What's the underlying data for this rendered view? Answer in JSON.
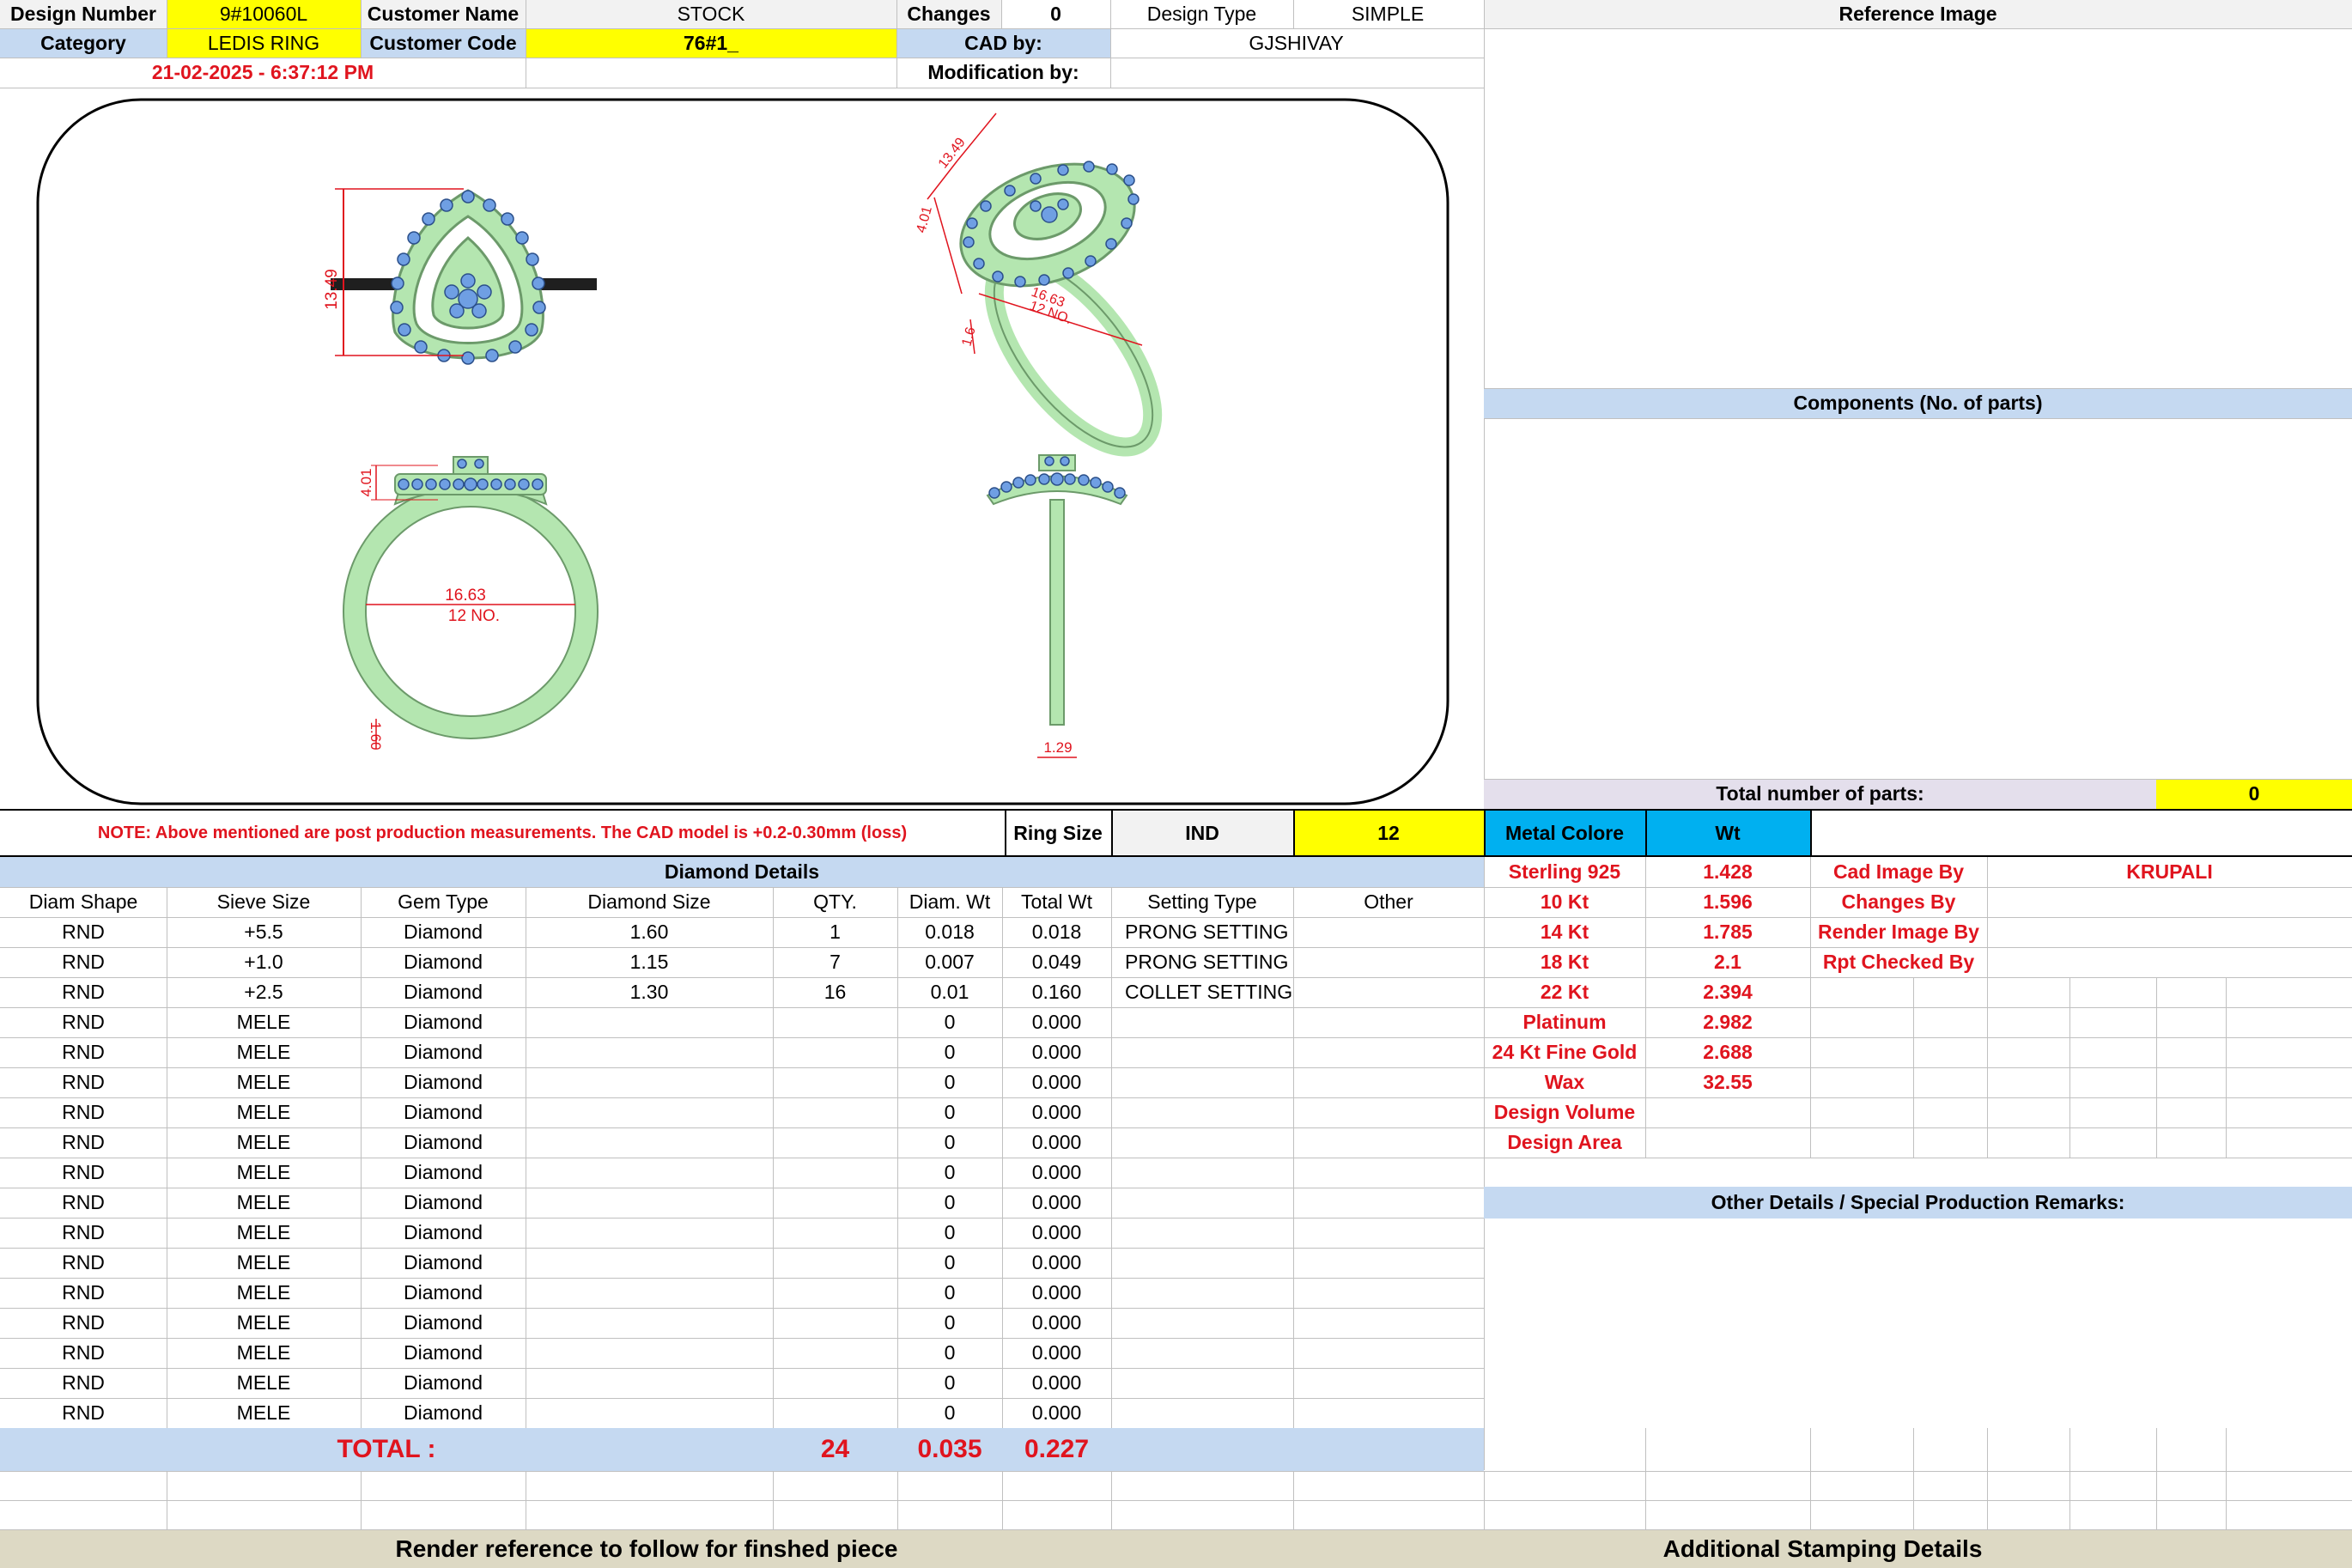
{
  "header": {
    "design_number_label": "Design Number",
    "design_number": "9#10060L",
    "customer_name_label": "Customer Name",
    "customer_name": "STOCK",
    "changes_label": "Changes",
    "changes": "0",
    "design_type_label": "Design Type",
    "design_type": "SIMPLE",
    "reference_image_label": "Reference Image",
    "category_label": "Category",
    "category": "LEDIS RING",
    "customer_code_label": "Customer Code",
    "customer_code": "76#1_",
    "cad_by_label": "CAD by:",
    "cad_by": "GJSHIVAY",
    "timestamp": "21-02-2025 - 6:37:12 PM",
    "modification_by_label": "Modification by:"
  },
  "drawing": {
    "dim_height": "13.49",
    "dim_head": "4.01",
    "dim_inner": "16.63",
    "dim_size": "12 NO.",
    "dim_shank": "1.60",
    "dim_width": "1.29",
    "persp_width": "13.49",
    "persp_head": "4.01",
    "persp_inner": "16.63",
    "persp_size": "12 NO.",
    "persp_shank": "1.6"
  },
  "components": {
    "label": "Components (No. of parts)",
    "total_label": "Total number of parts:",
    "total": "0"
  },
  "note": "NOTE: Above mentioned are post production measurements. The CAD model is +0.2-0.30mm (loss)",
  "ring": {
    "size_label": "Ring Size",
    "standard": "IND",
    "size": "12",
    "metal_label": "Metal Colore",
    "wt_label": "Wt"
  },
  "diamond": {
    "title": "Diamond Details",
    "columns": [
      "Diam Shape",
      "Sieve Size",
      "Gem Type",
      "Diamond Size",
      "QTY.",
      "Diam. Wt",
      "Total Wt",
      "Setting Type",
      "Other"
    ],
    "rows": [
      [
        "RND",
        "+5.5",
        "Diamond",
        "1.60",
        "1",
        "0.018",
        "0.018",
        "PRONG SETTING",
        ""
      ],
      [
        "RND",
        "+1.0",
        "Diamond",
        "1.15",
        "7",
        "0.007",
        "0.049",
        "PRONG SETTING",
        ""
      ],
      [
        "RND",
        "+2.5",
        "Diamond",
        "1.30",
        "16",
        "0.01",
        "0.160",
        "COLLET SETTING",
        ""
      ],
      [
        "RND",
        "MELE",
        "Diamond",
        "",
        "",
        "0",
        "0.000",
        "",
        ""
      ],
      [
        "RND",
        "MELE",
        "Diamond",
        "",
        "",
        "0",
        "0.000",
        "",
        ""
      ],
      [
        "RND",
        "MELE",
        "Diamond",
        "",
        "",
        "0",
        "0.000",
        "",
        ""
      ],
      [
        "RND",
        "MELE",
        "Diamond",
        "",
        "",
        "0",
        "0.000",
        "",
        ""
      ],
      [
        "RND",
        "MELE",
        "Diamond",
        "",
        "",
        "0",
        "0.000",
        "",
        ""
      ],
      [
        "RND",
        "MELE",
        "Diamond",
        "",
        "",
        "0",
        "0.000",
        "",
        ""
      ],
      [
        "RND",
        "MELE",
        "Diamond",
        "",
        "",
        "0",
        "0.000",
        "",
        ""
      ],
      [
        "RND",
        "MELE",
        "Diamond",
        "",
        "",
        "0",
        "0.000",
        "",
        ""
      ],
      [
        "RND",
        "MELE",
        "Diamond",
        "",
        "",
        "0",
        "0.000",
        "",
        ""
      ],
      [
        "RND",
        "MELE",
        "Diamond",
        "",
        "",
        "0",
        "0.000",
        "",
        ""
      ],
      [
        "RND",
        "MELE",
        "Diamond",
        "",
        "",
        "0",
        "0.000",
        "",
        ""
      ],
      [
        "RND",
        "MELE",
        "Diamond",
        "",
        "",
        "0",
        "0.000",
        "",
        ""
      ],
      [
        "RND",
        "MELE",
        "Diamond",
        "",
        "",
        "0",
        "0.000",
        "",
        ""
      ],
      [
        "RND",
        "MELE",
        "Diamond",
        "",
        "",
        "0",
        "0.000",
        "",
        ""
      ]
    ],
    "total_label": "TOTAL :",
    "total_qty": "24",
    "total_diam_wt": "0.035",
    "total_wt": "0.227"
  },
  "metals": [
    {
      "name": "Sterling 925",
      "wt": "1.428"
    },
    {
      "name": "10 Kt",
      "wt": "1.596"
    },
    {
      "name": "14 Kt",
      "wt": "1.785"
    },
    {
      "name": "18 Kt",
      "wt": "2.1"
    },
    {
      "name": "22 Kt",
      "wt": "2.394"
    },
    {
      "name": "Platinum",
      "wt": "2.982"
    },
    {
      "name": "24 Kt Fine Gold",
      "wt": "2.688"
    },
    {
      "name": "Wax",
      "wt": "32.55"
    },
    {
      "name": "Design Volume",
      "wt": ""
    },
    {
      "name": "Design Area",
      "wt": ""
    }
  ],
  "credits": [
    {
      "label": "Cad Image By",
      "value": "KRUPALI"
    },
    {
      "label": "Changes By",
      "value": ""
    },
    {
      "label": "Render Image By",
      "value": ""
    },
    {
      "label": "Rpt Checked By",
      "value": ""
    }
  ],
  "remarks_label": "Other Details / Special Production Remarks:",
  "footer": {
    "render_ref": "Render reference to follow for finshed piece",
    "stamping": "Additional Stamping Details"
  },
  "colors": {
    "metal": "#b4e6b0",
    "stone": "#6f9fe3",
    "dimension": "#e0141e",
    "header_blue": "#c5d9f1",
    "highlight": "#ffff00"
  }
}
